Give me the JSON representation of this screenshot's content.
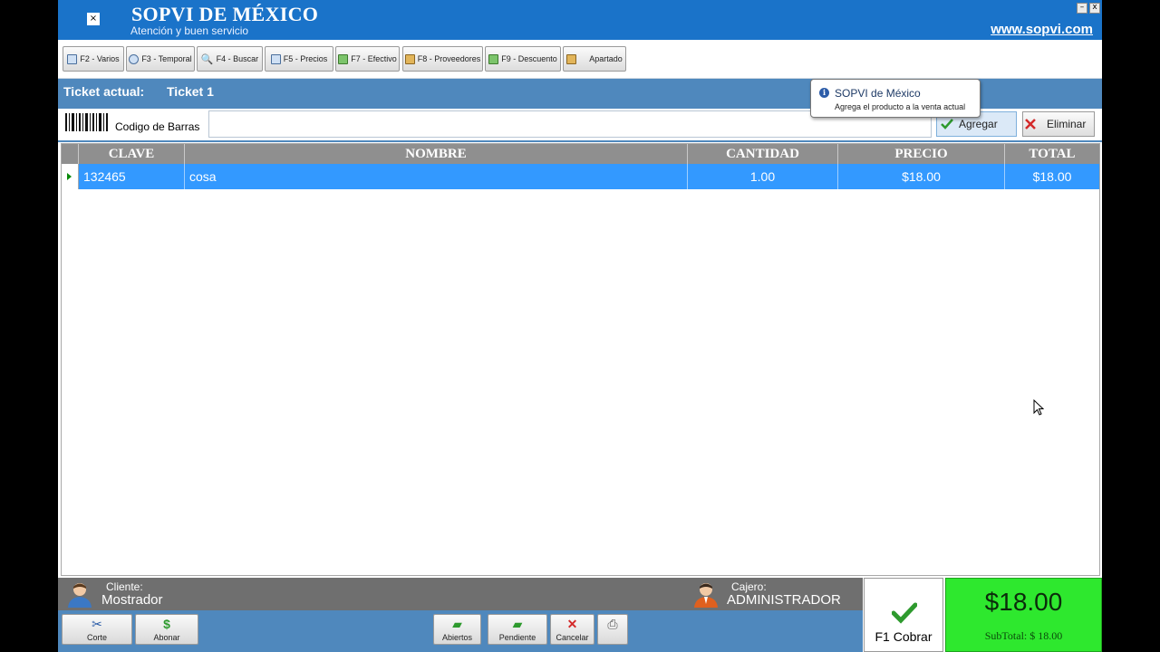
{
  "header": {
    "close_glyph": "×",
    "title": "SOPVI DE MÉXICO",
    "subtitle": "Atención y buen servicio",
    "website": "www.sopvi.com",
    "minimize_glyph": "–",
    "close_window_glyph": "x"
  },
  "toolbar": {
    "buttons": [
      {
        "label": "F2 - Varios",
        "icon": "grid-icon"
      },
      {
        "label": "F3 - Temporal",
        "icon": "clock-icon"
      },
      {
        "label": "F4 - Buscar",
        "icon": "magnifier-icon"
      },
      {
        "label": "F5 - Precios",
        "icon": "table-icon"
      },
      {
        "label": "F7 - Efectivo",
        "icon": "money-icon"
      },
      {
        "label": "F8 - Proveedores",
        "icon": "people-icon"
      },
      {
        "label": "F9 - Descuento",
        "icon": "money-icon"
      },
      {
        "label": "Apartado",
        "icon": "people-icon"
      }
    ]
  },
  "ticket": {
    "label": "Ticket  actual:",
    "value": "Ticket 1"
  },
  "barcode": {
    "label": "Codigo de Barras",
    "value": "",
    "add_label": "Agregar",
    "delete_label": "Eliminar"
  },
  "tooltip": {
    "title": "SOPVI de México",
    "text": "Agrega el producto a la venta actual"
  },
  "grid": {
    "columns": [
      "CLAVE",
      "NOMBRE",
      "CANTIDAD",
      "PRECIO",
      "TOTAL"
    ],
    "rows": [
      {
        "clave": "132465",
        "nombre": "cosa",
        "cantidad": "1.00",
        "precio": "$18.00",
        "total": "$18.00"
      }
    ]
  },
  "status": {
    "client_label": "Cliente:",
    "client_value": "Mostrador",
    "cashier_label": "Cajero:",
    "cashier_value": "ADMINISTRADOR"
  },
  "bottom": {
    "corte": "Corte",
    "abonar": "Abonar",
    "abiertos": "Abiertos",
    "pendiente": "Pendiente",
    "cancelar": "Cancelar",
    "cobrar": "F1 Cobrar",
    "total": "$18.00",
    "subtotal": "SubTotal: $ 18.00"
  },
  "colors": {
    "header_blue": "#1a73c9",
    "panel_blue": "#4f88bd",
    "row_selected": "#3399ff",
    "total_green": "#2ee82e"
  }
}
